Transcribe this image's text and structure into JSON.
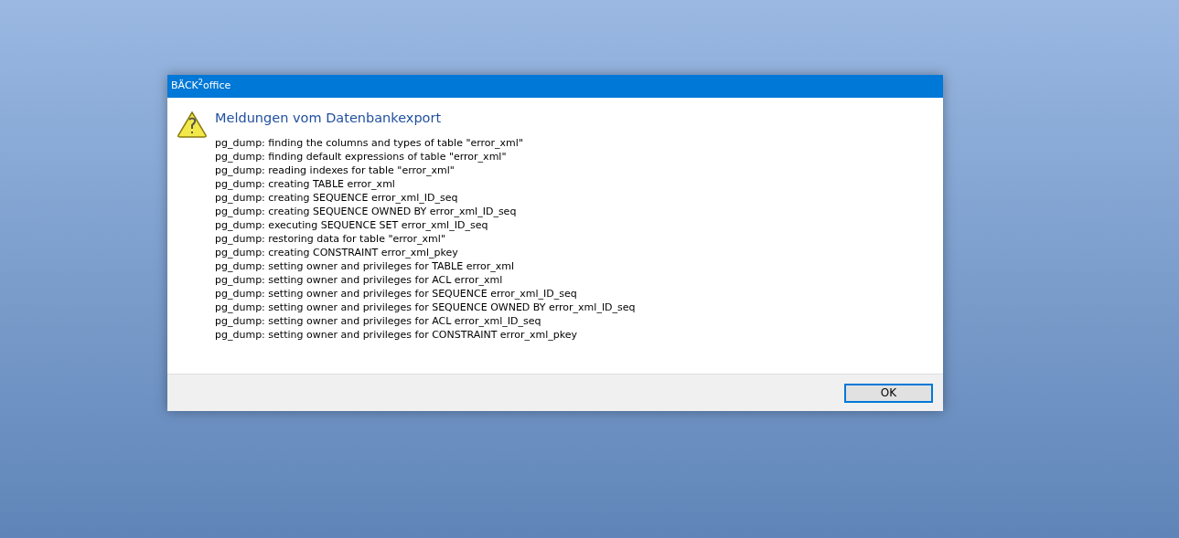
{
  "window": {
    "title": "BÄCK$^{2}$office"
  },
  "heading": "Meldungen vom Datenbankexport",
  "messages": [
    "pg_dump: finding the columns and types of table \"error_xml\"",
    "pg_dump: finding default expressions of table \"error_xml\"",
    "pg_dump: reading indexes for table \"error_xml\"",
    "pg_dump: creating TABLE error_xml",
    "pg_dump: creating SEQUENCE error_xml_ID_seq",
    "pg_dump: creating SEQUENCE OWNED BY error_xml_ID_seq",
    "pg_dump: executing SEQUENCE SET error_xml_ID_seq",
    "pg_dump: restoring data for table \"error_xml\"",
    "pg_dump: creating CONSTRAINT error_xml_pkey",
    "pg_dump: setting owner and privileges for TABLE error_xml",
    "pg_dump: setting owner and privileges for ACL error_xml",
    "pg_dump: setting owner and privileges for SEQUENCE error_xml_ID_seq",
    "pg_dump: setting owner and privileges for SEQUENCE OWNED BY error_xml_ID_seq",
    "pg_dump: setting owner and privileges for ACL error_xml_ID_seq",
    "pg_dump: setting owner and privileges for CONSTRAINT error_xml_pkey"
  ],
  "buttons": [
    "OK"
  ]
}
